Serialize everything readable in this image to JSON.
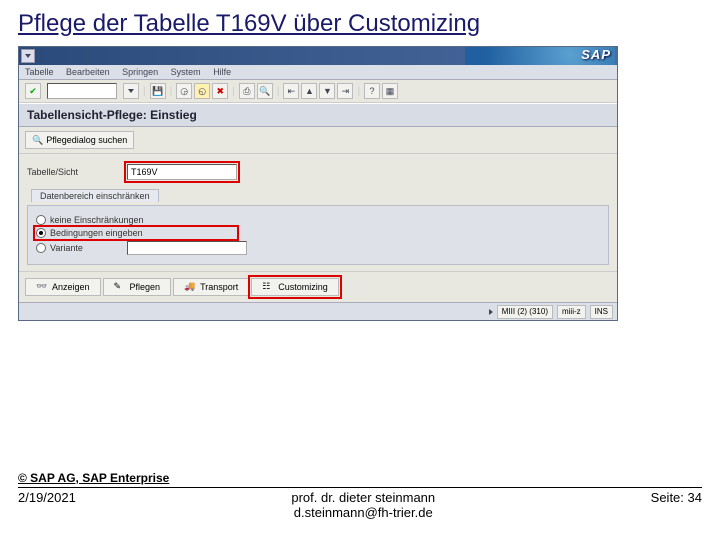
{
  "slide": {
    "title": "Pflege der Tabelle T169V über Customizing",
    "copyright": "© SAP AG, SAP Enterprise",
    "date": "2/19/2021",
    "author_line1": "prof. dr. dieter steinmann",
    "author_line2": "d.steinmann@fh-trier.de",
    "page": "Seite: 34"
  },
  "sap": {
    "logo": "SAP",
    "menu": {
      "m1": "Tabelle",
      "m2": "Bearbeiten",
      "m3": "Springen",
      "m4": "System",
      "m5": "Hilfe"
    },
    "subtitle": "Tabellensicht-Pflege: Einstieg",
    "catalog_btn": "Pflegedialog suchen",
    "field": {
      "label": "Tabelle/Sicht",
      "value": "T169V"
    },
    "group": {
      "title": "Datenbereich einschränken",
      "r1": "keine Einschränkungen",
      "r2": "Bedingungen eingeben",
      "r3": "Variante"
    },
    "buttons": {
      "anzeigen": "Anzeigen",
      "pflegen": "Pflegen",
      "transport": "Transport",
      "customizing": "Customizing"
    },
    "status": {
      "client": "MIII (2) (310)",
      "server": "miii-z",
      "ins": "INS"
    }
  }
}
